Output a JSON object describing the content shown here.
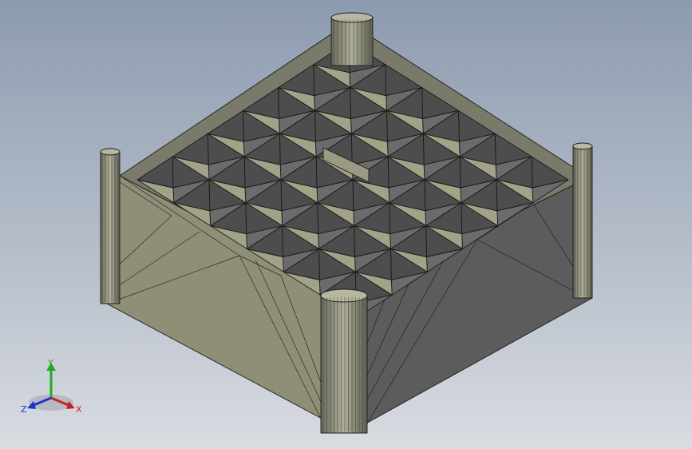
{
  "viewport": {
    "background_top": "#8d9bb0",
    "background_bottom": "#d9dce1"
  },
  "model": {
    "part": "grid-tray",
    "grid_cells": "6x6",
    "face_colors": {
      "left_face": "#8f8f78",
      "right_face": "#5c5c5c",
      "rim": "#7a7a6a",
      "cell_wall_light": "#a2a288",
      "cell_wall_dark": "#4d4d4d",
      "cell_floor": "#6b6b6b",
      "corner_post": "#8a8a78"
    }
  },
  "triad": {
    "x_label": "X",
    "y_label": "Y",
    "z_label": "Z",
    "x_color": "#cc2222",
    "y_color": "#22aa22",
    "z_color": "#2233cc"
  }
}
